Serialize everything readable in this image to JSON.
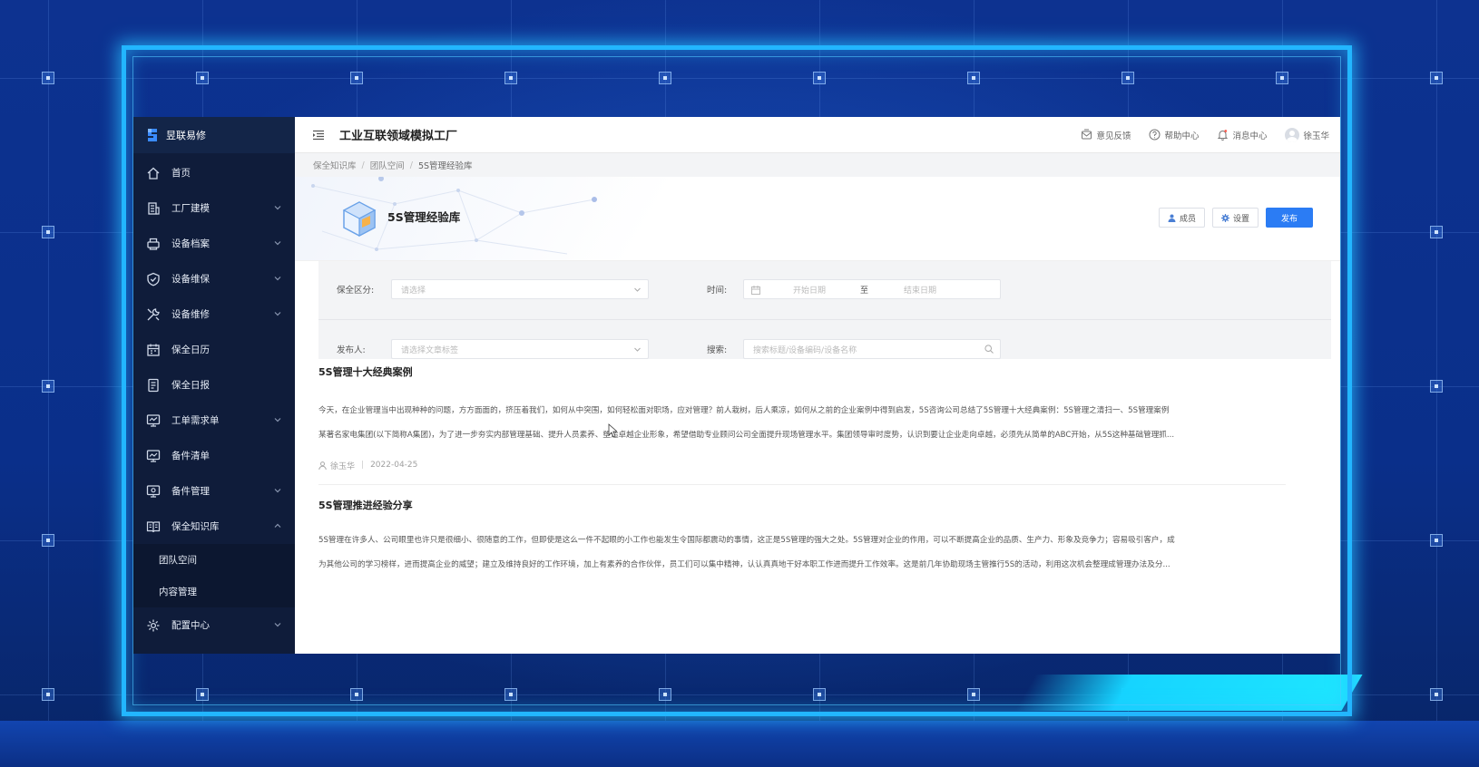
{
  "sidebar": {
    "brand": "昱联易修",
    "items": [
      {
        "label": "首页",
        "icon": "home-icon",
        "expandable": false
      },
      {
        "label": "工厂建模",
        "icon": "building-icon",
        "expandable": true
      },
      {
        "label": "设备档案",
        "icon": "printer-icon",
        "expandable": true
      },
      {
        "label": "设备维保",
        "icon": "shield-icon",
        "expandable": true
      },
      {
        "label": "设备维修",
        "icon": "wrench-icon",
        "expandable": true
      },
      {
        "label": "保全日历",
        "icon": "calendar-icon",
        "expandable": false
      },
      {
        "label": "保全日报",
        "icon": "report-icon",
        "expandable": false
      },
      {
        "label": "工单需求单",
        "icon": "monitor-icon",
        "expandable": true
      },
      {
        "label": "备件清单",
        "icon": "monitor-chart-icon",
        "expandable": false
      },
      {
        "label": "备件管理",
        "icon": "monitor-gear-icon",
        "expandable": true
      },
      {
        "label": "保全知识库",
        "icon": "book-icon",
        "expandable": true,
        "expanded": true
      }
    ],
    "sub_items": [
      "团队空间",
      "内容管理"
    ],
    "config": {
      "label": "配置中心",
      "icon": "gear-icon"
    }
  },
  "topbar": {
    "title": "工业互联领域模拟工厂",
    "nav": {
      "feedback": "意见反馈",
      "help": "帮助中心",
      "messages": "消息中心",
      "user": "徐玉华"
    }
  },
  "breadcrumb": [
    "保全知识库",
    "团队空间",
    "5S管理经验库"
  ],
  "hero": {
    "title": "5S管理经验库",
    "members_label": "成员",
    "settings_label": "设置",
    "publish_label": "发布"
  },
  "filters": {
    "category_label": "保全区分:",
    "category_placeholder": "请选择",
    "time_label": "时间:",
    "start_placeholder": "开始日期",
    "range_sep": "至",
    "end_placeholder": "结束日期",
    "publisher_label": "发布人:",
    "publisher_placeholder": "请选择文章标签",
    "search_label": "搜索:",
    "search_placeholder": "搜索标题/设备编码/设备名称"
  },
  "articles": [
    {
      "title": "5S管理十大经典案例",
      "line1": "今天，在企业管理当中出现种种的问题，方方面面的，挤压着我们，如何从中突围，如何轻松面对职场，应对管理？前人栽树，后人乘凉，如何从之前的企业案例中得到启发，5S咨询公司总结了5S管理十大经典案例：5S管理之清扫一、5S管理案例",
      "line2": "某著名家电集团(以下简称A集团)，为了进一步夯实内部管理基础、提升人员素养、塑造卓越企业形象，希望借助专业顾问公司全面提升现场管理水平。集团领导审时度势，认识到要让企业走向卓越，必须先从简单的ABC开始，从5S这种基础管理抓...",
      "author": "徐玉华",
      "date": "2022-04-25"
    },
    {
      "title": "5S管理推进经验分享",
      "line1": "5S管理在许多人、公司眼里也许只是很细小、很随意的工作，但即使是这么一件不起眼的小工作也能发生令国际都震动的事情，这正是5S管理的强大之处。5S管理对企业的作用，可以不断提高企业的品质、生产力、形象及竞争力；容易吸引客户，成",
      "line2": "为其他公司的学习榜样，进而提高企业的威望；建立及维持良好的工作环境，加上有素养的合作伙伴，员工们可以集中精神，认认真真地干好本职工作进而提升工作效率。这是前几年协助现场主管推行5S的活动，利用这次机会整理成管理办法及分..."
    }
  ],
  "colors": {
    "sidebar_bg": "#0f1c3a",
    "primary": "#2b7cf4",
    "frame_glow": "#22b6ff"
  }
}
